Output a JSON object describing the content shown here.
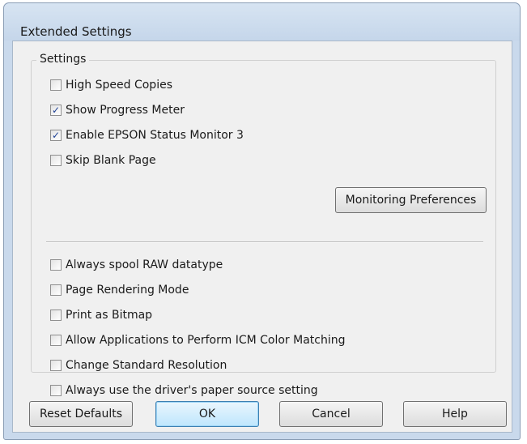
{
  "dialog": {
    "title": "Extended Settings"
  },
  "settings_group": {
    "legend": "Settings",
    "top_options": [
      {
        "label": "High Speed Copies",
        "checked": false
      },
      {
        "label": "Show Progress Meter",
        "checked": true
      },
      {
        "label": "Enable EPSON Status Monitor 3",
        "checked": true
      },
      {
        "label": "Skip Blank Page",
        "checked": false
      }
    ],
    "monitoring_button_label": "Monitoring Preferences",
    "bottom_options": [
      {
        "label": "Always spool RAW datatype",
        "checked": false
      },
      {
        "label": "Page Rendering Mode",
        "checked": false
      },
      {
        "label": "Print as Bitmap",
        "checked": false
      },
      {
        "label": "Allow Applications to Perform ICM Color Matching",
        "checked": false
      },
      {
        "label": "Change Standard Resolution",
        "checked": false
      },
      {
        "label": "Always use the driver's paper source setting",
        "checked": false
      }
    ]
  },
  "buttons": {
    "reset_defaults": "Reset Defaults",
    "ok": "OK",
    "cancel": "Cancel",
    "help": "Help"
  },
  "icons": {
    "checkmark": "checkmark-icon",
    "checkmark_glyph": "✓"
  },
  "colors": {
    "titlebar": "#c9d9ec",
    "client_bg": "#f0f0f0",
    "default_button": "#bee6fd",
    "check_color": "#1c3f94"
  }
}
